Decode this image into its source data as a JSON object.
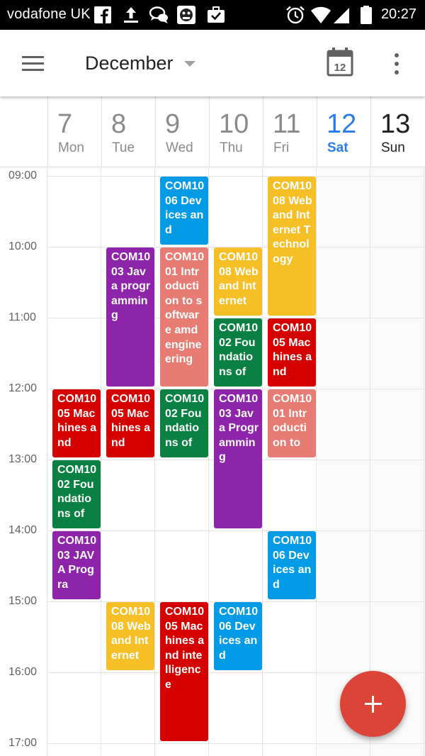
{
  "status_bar": {
    "carrier": "vodafone UK",
    "time": "20:27",
    "icons": [
      "facebook-icon",
      "upload-icon",
      "chat-bubbles-icon",
      "gorilla-app-icon",
      "briefcase-check-icon",
      "alarm-icon",
      "wifi-icon",
      "signal-icon",
      "battery-icon"
    ]
  },
  "app_bar": {
    "month": "December",
    "today_date": "12",
    "icons": [
      "menu-icon",
      "dropdown-arrow-icon",
      "calendar-today-icon",
      "more-vert-icon"
    ]
  },
  "days": [
    {
      "num": "7",
      "name": "Mon"
    },
    {
      "num": "8",
      "name": "Tue"
    },
    {
      "num": "9",
      "name": "Wed"
    },
    {
      "num": "10",
      "name": "Thu"
    },
    {
      "num": "11",
      "name": "Fri"
    },
    {
      "num": "12",
      "name": "Sat",
      "today": true
    },
    {
      "num": "13",
      "name": "Sun"
    }
  ],
  "times": [
    "09:00",
    "10:00",
    "11:00",
    "12:00",
    "13:00",
    "14:00",
    "15:00",
    "16:00",
    "17:00"
  ],
  "colors": {
    "blue": "#039be5",
    "yellow": "#f6bf26",
    "purple": "#8e24aa",
    "salmon": "#e67c73",
    "green": "#0b8043",
    "red": "#d50000",
    "today": "#2b7de9",
    "fab": "#db4437"
  },
  "events": [
    {
      "day": 2,
      "start": 9,
      "end": 10,
      "color": "blue",
      "text": "COM1006 Devices and"
    },
    {
      "day": 4,
      "start": 9,
      "end": 11,
      "color": "yellow",
      "text": "COM1008 Web and Internet Technology"
    },
    {
      "day": 1,
      "start": 10,
      "end": 12,
      "color": "purple",
      "text": "COM1003 Java programming"
    },
    {
      "day": 2,
      "start": 10,
      "end": 12,
      "color": "salmon",
      "text": "COM1001 Introduction to software amd engineering"
    },
    {
      "day": 3,
      "start": 10,
      "end": 11,
      "color": "yellow",
      "text": "COM1008 Web and Internet"
    },
    {
      "day": 3,
      "start": 11,
      "end": 12,
      "color": "green",
      "text": "COM1002 Foundations of"
    },
    {
      "day": 4,
      "start": 11,
      "end": 12,
      "color": "red",
      "text": "COM1005 Machines and"
    },
    {
      "day": 0,
      "start": 12,
      "end": 13,
      "color": "red",
      "text": "COM1005 Machines and"
    },
    {
      "day": 1,
      "start": 12,
      "end": 13,
      "color": "red",
      "text": "COM1005 Machines and"
    },
    {
      "day": 2,
      "start": 12,
      "end": 13,
      "color": "green",
      "text": "COM1002 Foundations of"
    },
    {
      "day": 3,
      "start": 12,
      "end": 14,
      "color": "purple",
      "text": "COM1003 Java Programming"
    },
    {
      "day": 4,
      "start": 12,
      "end": 13,
      "color": "salmon",
      "text": "COM1001 Introduction to"
    },
    {
      "day": 0,
      "start": 13,
      "end": 14,
      "color": "green",
      "text": "COM1002 Foundations of"
    },
    {
      "day": 0,
      "start": 14,
      "end": 15,
      "color": "purple",
      "text": "COM1003 JAVA Progra"
    },
    {
      "day": 4,
      "start": 14,
      "end": 15,
      "color": "blue",
      "text": "COM1006 Devices and"
    },
    {
      "day": 1,
      "start": 15,
      "end": 16,
      "color": "yellow",
      "text": "COM1008 Web and Internet"
    },
    {
      "day": 2,
      "start": 15,
      "end": 17,
      "color": "red",
      "text": "COM1005 Machines and intelligence"
    },
    {
      "day": 3,
      "start": 15,
      "end": 16,
      "color": "blue",
      "text": "COM1006 Devices and"
    }
  ],
  "fab": {
    "label": "+",
    "icon": "add-icon"
  }
}
